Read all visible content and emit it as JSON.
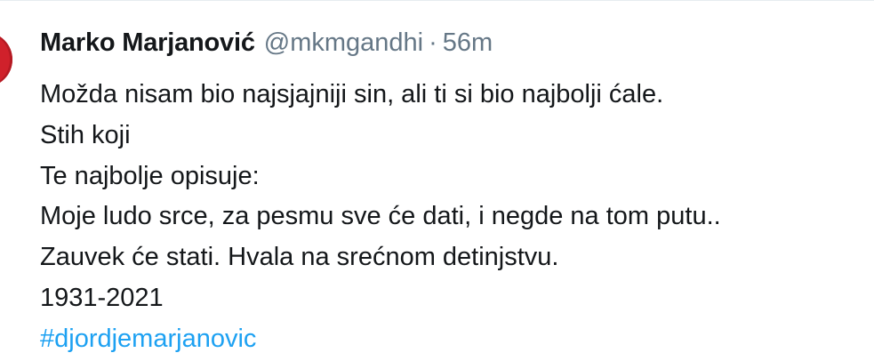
{
  "tweet": {
    "display_name": "Marko Marjanović",
    "handle": "@mkmgandhi",
    "separator": "·",
    "time": "56m",
    "lines": [
      "Možda nisam bio najsjajniji sin, ali ti si bio najbolji ćale.",
      "Stih koji",
      "Te najbolje opisuje:",
      "Moje ludo srce, za pesmu sve će dati, i negde na tom putu..",
      "Zauvek će stati. Hvala na srećnom detinjstvu.",
      "1931-2021"
    ],
    "hashtag": "#djordjemarjanovic"
  },
  "colors": {
    "text": "#14171a",
    "muted": "#657786",
    "link": "#1da1f2",
    "avatar": "#d0212b"
  }
}
